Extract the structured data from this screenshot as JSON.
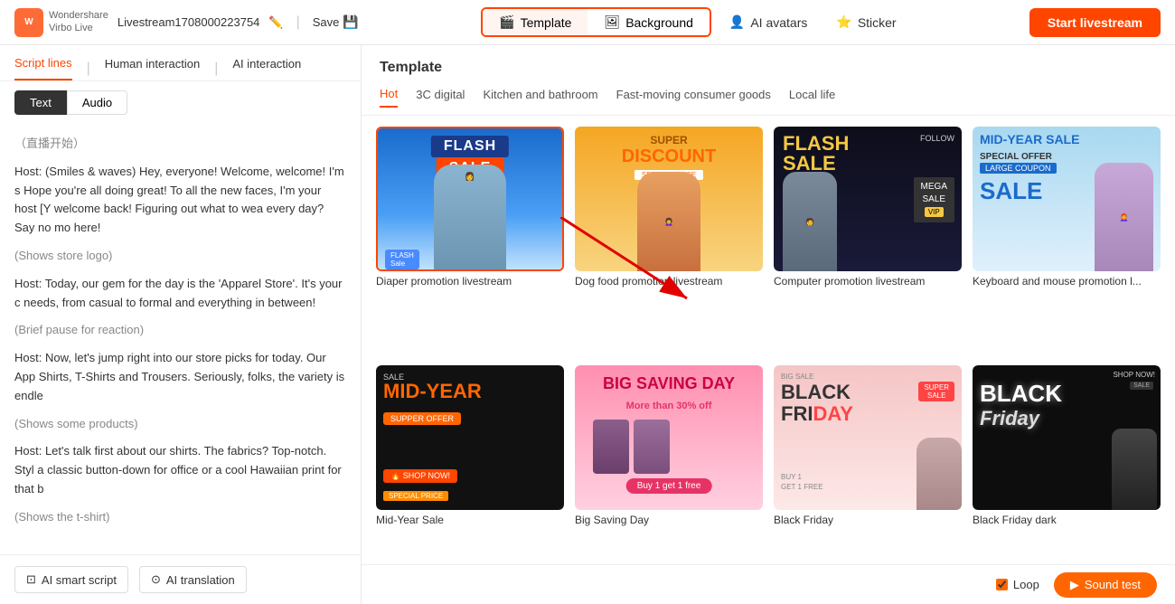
{
  "topbar": {
    "brand_name": "Wondershare",
    "brand_sub": "Virbo Live",
    "stream_id": "Livestream1708000223754",
    "save_label": "Save",
    "tab_template": "Template",
    "tab_background": "Background",
    "nav_ai_avatars": "AI avatars",
    "nav_sticker": "Sticker",
    "start_btn": "Start livestream"
  },
  "left_panel": {
    "nav_items": [
      "Script lines",
      "Human interaction",
      "AI interaction"
    ],
    "tabs": [
      "Text",
      "Audio"
    ],
    "active_tab": "Text",
    "script_lines": [
      {
        "type": "gray",
        "text": "（直播开始）"
      },
      {
        "type": "normal",
        "text": "Host: (Smiles & waves) Hey, everyone! Welcome, welcome! I'm s Hope you're all doing great! To all the new faces, I'm your host [Y welcome back! Figuring out what to wea every day? Say no mo here!"
      },
      {
        "type": "gray",
        "text": "(Shows store logo)"
      },
      {
        "type": "normal",
        "text": "Host: Today, our gem for the day is the 'Apparel Store'. It's your c needs, from casual to formal and everything in between!"
      },
      {
        "type": "gray",
        "text": "(Brief pause for reaction)"
      },
      {
        "type": "normal",
        "text": "Host: Now, let's jump right into our store picks for today. Our App Shirts, T-Shirts and Trousers. Seriously, folks, the variety is endle"
      },
      {
        "type": "gray",
        "text": "(Shows some products)"
      },
      {
        "type": "normal",
        "text": "Host: Let's talk first about our shirts. The fabrics? Top-notch. Styl a classic button-down for office or a cool Hawaiian print for that b"
      },
      {
        "type": "gray",
        "text": "(Shows the t-shirt)"
      }
    ],
    "bottom_btns": [
      {
        "label": "AI smart script",
        "icon": "ai-icon"
      },
      {
        "label": "AI translation",
        "icon": "translation-icon"
      }
    ]
  },
  "template_panel": {
    "title": "Template",
    "categories": [
      "Hot",
      "3C digital",
      "Kitchen and bathroom",
      "Fast-moving consumer goods",
      "Local life"
    ],
    "active_category": "Hot",
    "templates": [
      {
        "id": 1,
        "label": "Diaper promotion livestream",
        "selected": true,
        "style": "blue-flash"
      },
      {
        "id": 2,
        "label": "Dog food promotion livestream",
        "selected": false,
        "style": "yellow-super"
      },
      {
        "id": 3,
        "label": "Computer promotion livestream",
        "selected": false,
        "style": "dark-flash"
      },
      {
        "id": 4,
        "label": "Keyboard and mouse promotion l...",
        "selected": false,
        "style": "light-blue"
      },
      {
        "id": 5,
        "label": "Mid-Year Sale",
        "selected": false,
        "style": "dark-midyear"
      },
      {
        "id": 6,
        "label": "Big Saving Day",
        "selected": false,
        "style": "pink-saving"
      },
      {
        "id": 7,
        "label": "Black Friday",
        "selected": false,
        "style": "pink-blackfriday"
      },
      {
        "id": 8,
        "label": "Black Friday dark",
        "selected": false,
        "style": "dark-blackfriday"
      }
    ]
  },
  "bottom_bar": {
    "loop_label": "Loop",
    "sound_label": "Sound test"
  }
}
